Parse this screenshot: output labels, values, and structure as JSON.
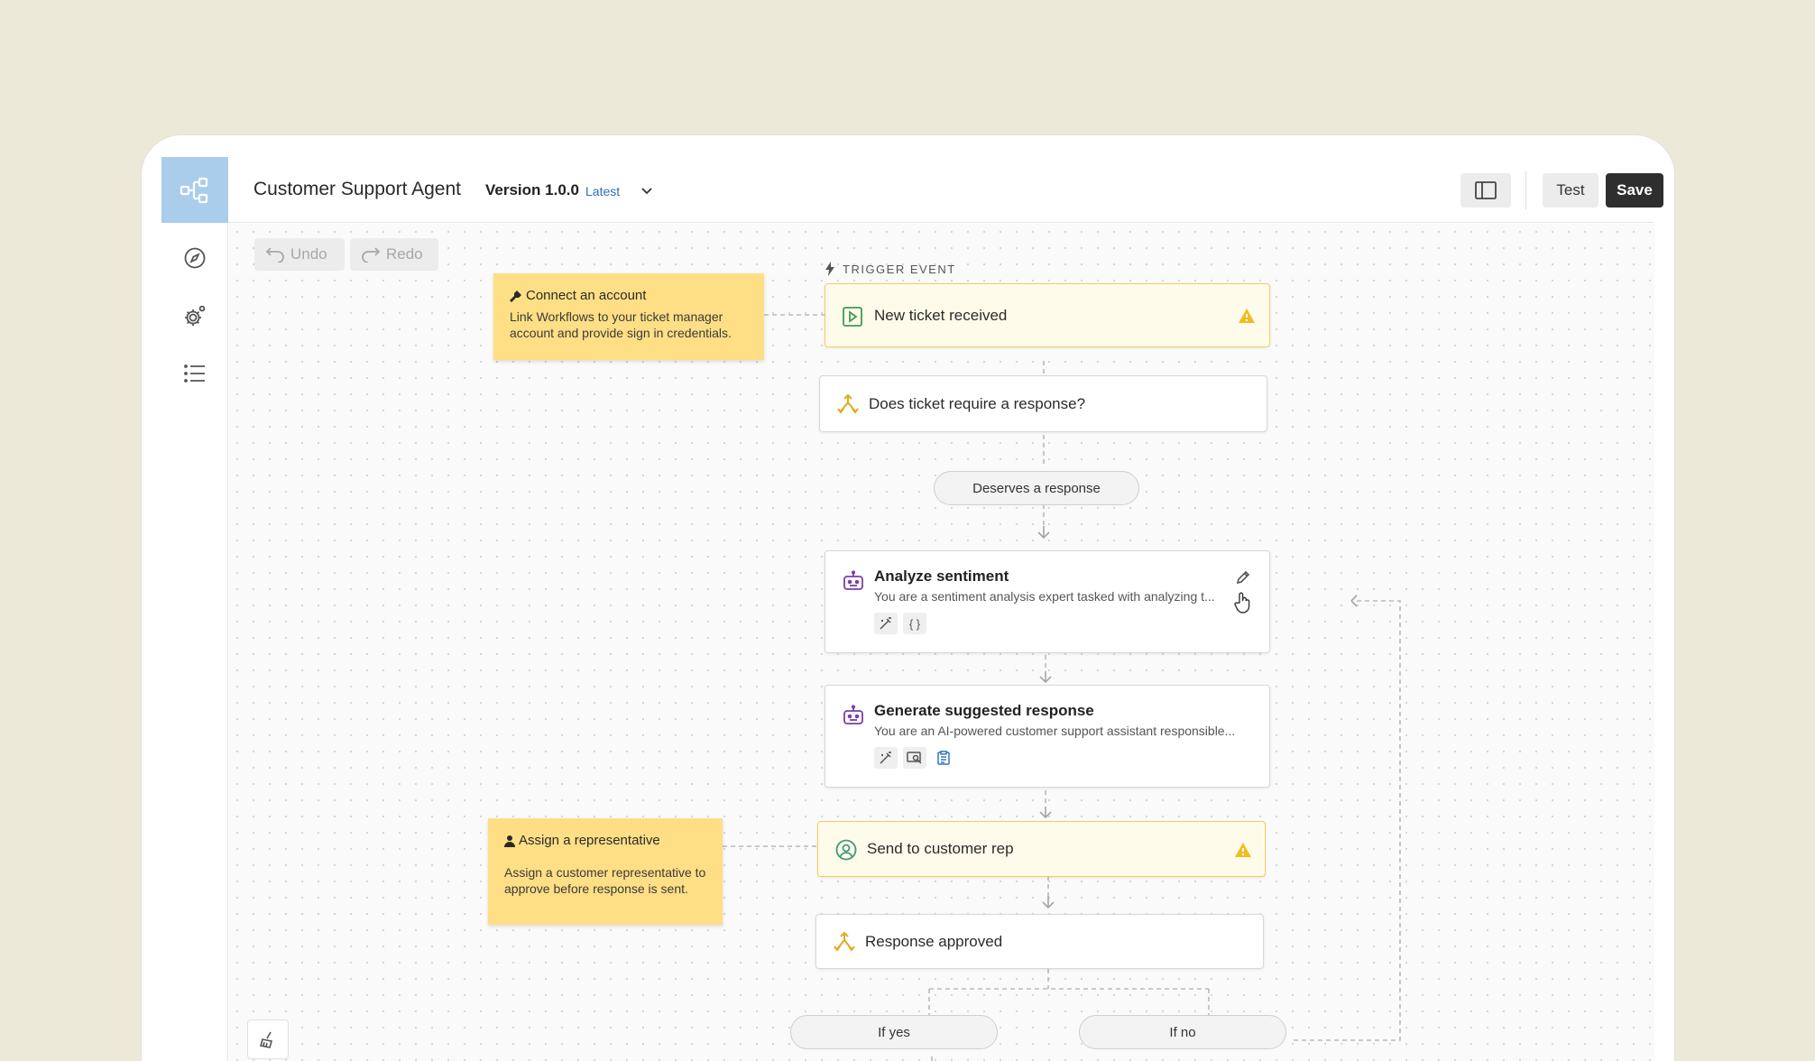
{
  "header": {
    "title": "Customer Support Agent",
    "version": "Version 1.0.0",
    "version_tag": "Latest",
    "test_label": "Test",
    "save_label": "Save"
  },
  "toolbar": {
    "undo_label": "Undo",
    "redo_label": "Redo"
  },
  "sidebar": {
    "items": [
      {
        "icon": "compass-icon"
      },
      {
        "icon": "gear-icon"
      },
      {
        "icon": "list-icon"
      }
    ]
  },
  "workflow": {
    "trigger_label": "TRIGGER EVENT",
    "nodes": {
      "trigger": {
        "title": "New ticket received"
      },
      "condition1": {
        "title": "Does ticket require a response?"
      },
      "branch1": {
        "label": "Deserves a response"
      },
      "analyze": {
        "title": "Analyze sentiment",
        "desc": "You are a sentiment analysis expert tasked with analyzing t..."
      },
      "generate": {
        "title": "Generate suggested response",
        "desc": "You are an AI-powered customer support assistant responsible..."
      },
      "send": {
        "title": "Send to customer rep"
      },
      "approved": {
        "title": "Response approved"
      },
      "if_yes": {
        "label": "If yes"
      },
      "if_no": {
        "label": "If no"
      }
    },
    "notes": {
      "connect": {
        "title": "Connect an account",
        "body": "Link Workflows to your ticket manager account and provide sign in credentials."
      },
      "assign": {
        "title": "Assign a representative",
        "body": "Assign a customer representative to approve before response is sent."
      }
    }
  },
  "colors": {
    "logo_bg": "#a9cdea",
    "warn_border": "#f1cf57",
    "sticky": "#fedf85",
    "accent_link": "#2f6db5",
    "save_bg": "#2e2e2e"
  }
}
